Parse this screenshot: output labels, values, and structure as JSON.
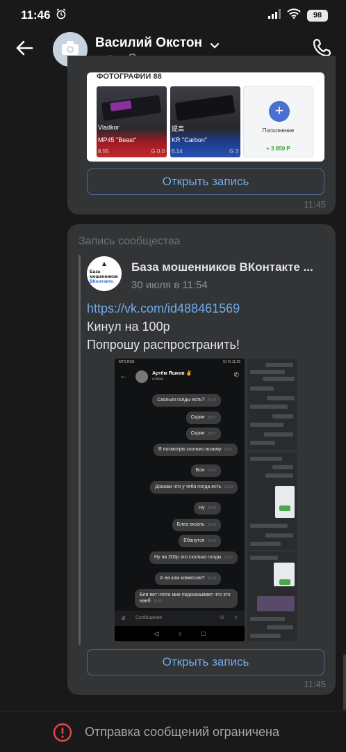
{
  "status_bar": {
    "time": "11:46",
    "battery": "98"
  },
  "header": {
    "contact_name": "Василий Окстон",
    "status": "online"
  },
  "messages": {
    "first": {
      "card_heading": "ФОТОГРАФИИ 88",
      "thumb1_name": "Vladkor",
      "thumb1_title": "MP45 \"Beast\"",
      "thumb1_price": "G 0.0",
      "thumb1_num": "8.55",
      "thumb2_title": "KR \"Carbon\"",
      "thumb2_top": "提高",
      "thumb2_num": "6.14",
      "thumb2_price": "G 3",
      "thumb3_title": "Пополнение",
      "thumb3_amount": "+ 3 850 Р",
      "open_button": "Открыть запись",
      "time": "11:45"
    },
    "second": {
      "repost_label": "Запись сообщества",
      "community_avatar_line1": "База",
      "community_avatar_line2": "мошенников",
      "community_avatar_line3": "ВКонтакте.",
      "community_name": "База мошенников ВКонтакте ...",
      "post_date": "30 июля в 11:54",
      "link": "https://vk.com/id488461569",
      "line1": "Кинул на 100р",
      "line2": "Попрошу распространить!",
      "open_button": "Открыть запись",
      "time": "11:45"
    }
  },
  "inner_screenshot": {
    "status_left": "MTS RUS",
    "status_right": "51 % 11:25",
    "name": "Артём Яшков ✌",
    "online": "online",
    "msgs": [
      {
        "text": "Сколько голды есть?",
        "time": "10:20"
      },
      {
        "text": "Скрин",
        "time": "10:21"
      },
      {
        "text": "Скрин",
        "time": "10:21"
      },
      {
        "text": "Я посмотрю сколько возьму",
        "time": "10:21"
      },
      {
        "text": "Всм",
        "time": "10:21"
      },
      {
        "text": "Докажи что у тебя голда есть",
        "time": "10:22"
      },
      {
        "text": "Ну",
        "time": "10:22"
      },
      {
        "text": "Блеа екоать",
        "time": "10:22"
      },
      {
        "text": "Ебанутся",
        "time": "10:22"
      },
      {
        "text": "Ну на 200р это сколько голды",
        "time": "10:22"
      },
      {
        "text": "А на ком комиссия?",
        "time": "10:23"
      },
      {
        "text": "Бля вот чтото мне подсказывает что это наеб",
        "time": "10:23"
      }
    ],
    "input_placeholder": "Сообщение"
  },
  "footer": {
    "restriction": "Отправка сообщений ограничена"
  },
  "colors": {
    "accent": "#71aaeb",
    "bubble": "#333435",
    "background": "#19191a",
    "warning": "#e64646"
  },
  "icons": [
    "back-arrow-icon",
    "camera-icon",
    "chevron-down-icon",
    "phone-icon",
    "mobile-icon",
    "warning-icon",
    "alarm-icon",
    "signal-icon",
    "wifi-icon"
  ]
}
